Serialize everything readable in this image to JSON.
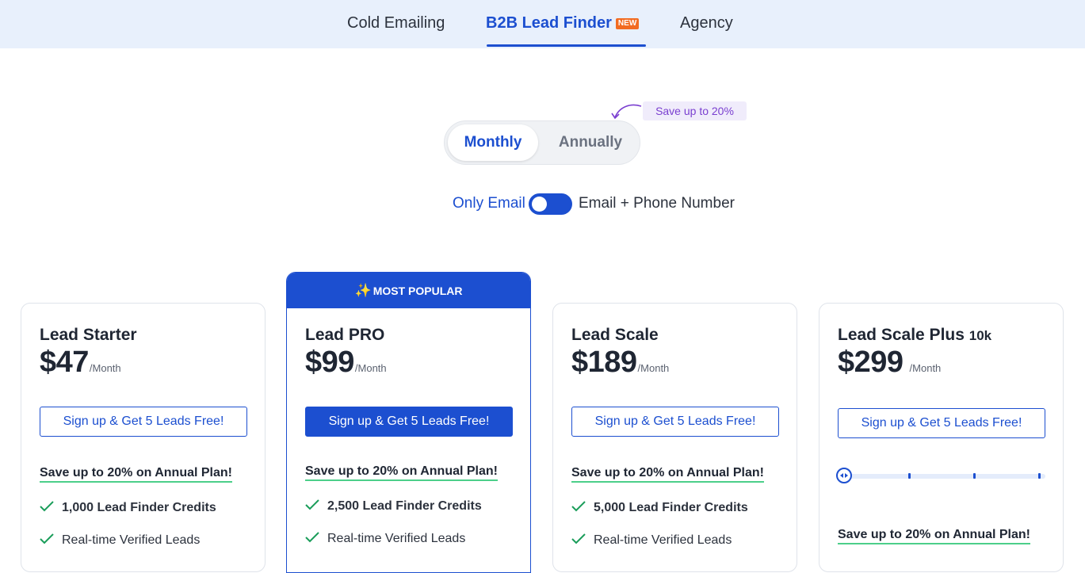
{
  "nav": {
    "tabs": [
      {
        "label": "Cold Emailing"
      },
      {
        "label": "B2B Lead Finder",
        "badge": "NEW"
      },
      {
        "label": "Agency"
      }
    ],
    "active_tab": "B2B Lead Finder"
  },
  "billing": {
    "save_badge": "Save up to 20%",
    "options": [
      "Monthly",
      "Annually"
    ],
    "selected": "Monthly"
  },
  "contact_toggle": {
    "left_label": "Only Email",
    "right_label": "Email + Phone Number",
    "state": "Only Email"
  },
  "popular_label": "MOST POPULAR",
  "plans": [
    {
      "name": "Lead Starter",
      "price": "$47",
      "period": "/Month",
      "cta": "Sign up & Get 5 Leads Free!",
      "save_text": "Save up to 20% on Annual Plan!",
      "features": [
        "1,000 Lead Finder Credits",
        "Real-time Verified Leads"
      ]
    },
    {
      "name": "Lead PRO",
      "price": "$99",
      "period": "/Month",
      "cta": "Sign up & Get 5 Leads Free!",
      "save_text": "Save up to 20% on Annual Plan!",
      "features": [
        "2,500 Lead Finder Credits",
        "Real-time Verified Leads"
      ],
      "popular": true
    },
    {
      "name": "Lead Scale",
      "price": "$189",
      "period": "/Month",
      "cta": "Sign up & Get 5 Leads Free!",
      "save_text": "Save up to 20% on Annual Plan!",
      "features": [
        "5,000 Lead Finder Credits",
        "Real-time Verified Leads"
      ]
    },
    {
      "name": "Lead Scale Plus",
      "name_suffix": "10k",
      "price": "$299",
      "period": "/Month",
      "cta": "Sign up & Get 5 Leads Free!",
      "save_text": "Save up to 20% on Annual Plan!",
      "slider_value": 0
    }
  ],
  "colors": {
    "accent": "#1c4fd0",
    "nav_bg": "#e8f0fc",
    "new_badge": "#f26b21",
    "save_purple": "#7a3fd0",
    "underline_green": "#4ccf8a",
    "check_green": "#1a9d5a"
  }
}
